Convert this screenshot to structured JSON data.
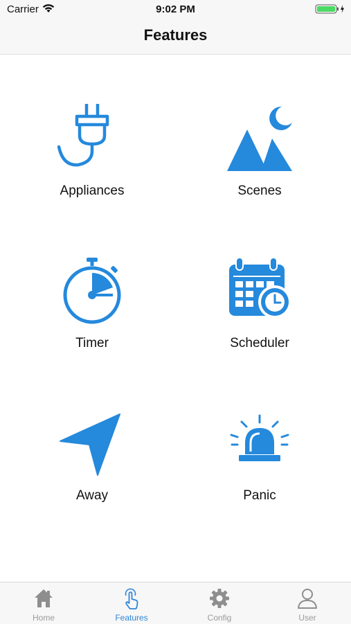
{
  "status": {
    "carrier": "Carrier",
    "time": "9:02 PM",
    "battery_color": "#4cd964"
  },
  "nav": {
    "title": "Features"
  },
  "accent_color": "#2589dc",
  "features": [
    {
      "label": "Appliances",
      "icon": "plug-icon"
    },
    {
      "label": "Scenes",
      "icon": "mountain-moon-icon"
    },
    {
      "label": "Timer",
      "icon": "stopwatch-icon"
    },
    {
      "label": "Scheduler",
      "icon": "calendar-clock-icon"
    },
    {
      "label": "Away",
      "icon": "navigation-arrow-icon"
    },
    {
      "label": "Panic",
      "icon": "siren-icon"
    }
  ],
  "tabs": [
    {
      "label": "Home",
      "icon": "home-icon",
      "active": false
    },
    {
      "label": "Features",
      "icon": "touch-hand-icon",
      "active": true
    },
    {
      "label": "Config",
      "icon": "gear-icon",
      "active": false
    },
    {
      "label": "User",
      "icon": "user-icon",
      "active": false
    }
  ]
}
